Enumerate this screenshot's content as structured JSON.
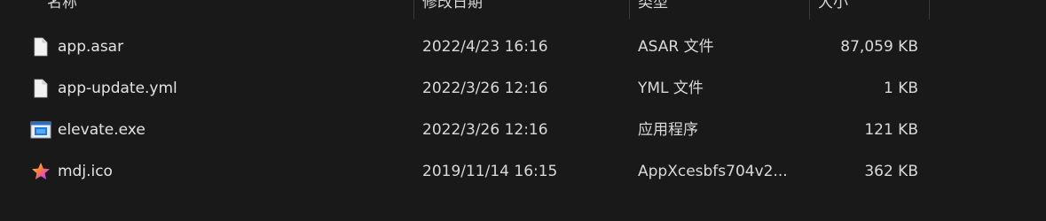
{
  "columns": {
    "name": "名称",
    "date": "修改日期",
    "type": "类型",
    "size": "大小"
  },
  "files": [
    {
      "name": "app.asar",
      "date": "2022/4/23 16:16",
      "type": "ASAR 文件",
      "size": "87,059 KB",
      "icon": "generic-file-icon"
    },
    {
      "name": "app-update.yml",
      "date": "2022/3/26 12:16",
      "type": "YML 文件",
      "size": "1 KB",
      "icon": "generic-file-icon"
    },
    {
      "name": "elevate.exe",
      "date": "2022/3/26 12:16",
      "type": "应用程序",
      "size": "121 KB",
      "icon": "application-window-icon"
    },
    {
      "name": "mdj.ico",
      "date": "2019/11/14 16:15",
      "type": "AppXcesbfs704v2...",
      "size": "362 KB",
      "icon": "star-image-icon"
    }
  ],
  "colors": {
    "background": "#191919",
    "text": "#e4e4e4",
    "separator": "#3a3a3a"
  }
}
